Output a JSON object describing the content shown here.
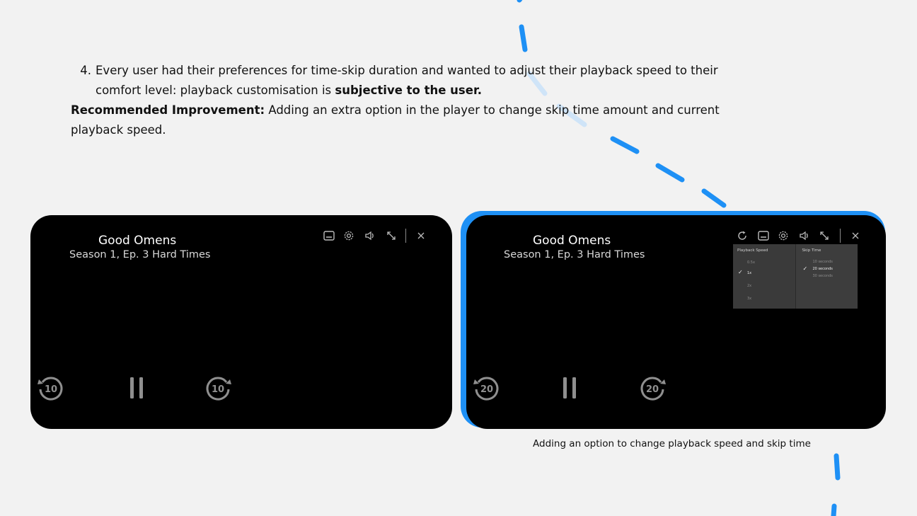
{
  "point": {
    "number": "4.",
    "line1": "Every user had their preferences for time-skip duration and wanted to adjust their playback speed to their",
    "line2_plain": "comfort level: playback customisation is ",
    "line2_bold": "subjective to the user."
  },
  "recommendation": {
    "label": "Recommended Improvement:",
    "text": " Adding an extra option in the player to change skip time amount and current",
    "text2": "playback speed."
  },
  "players": [
    {
      "title": "Good Omens",
      "subtitle": "Season 1, Ep. 3 Hard Times",
      "skip_back_label": "10",
      "skip_forward_label": "10"
    },
    {
      "title": "Good Omens",
      "subtitle": "Season 1, Ep. 3 Hard Times",
      "skip_back_label": "20",
      "skip_forward_label": "20"
    }
  ],
  "settings_menu": {
    "playback_speed": {
      "header": "Playback Speed",
      "options": [
        "0.5x",
        "1x",
        "2x",
        "3x"
      ],
      "selected": "1x"
    },
    "skip_time": {
      "header": "Skip Time",
      "options": [
        "10 seconds",
        "20 seconds",
        "30 seconds"
      ],
      "selected": "20 seconds"
    }
  },
  "caption": "Adding an option to change playback speed and skip time",
  "colors": {
    "accent": "#1e90f5",
    "background": "#f2f2f2",
    "player": "#000000"
  },
  "icons": [
    "subtitles-icon",
    "settings-gear-icon",
    "volume-icon",
    "fullscreen-icon",
    "close-icon",
    "replay-speed-icon",
    "rewind-icon",
    "pause-icon",
    "forward-icon",
    "checkmark-icon"
  ]
}
